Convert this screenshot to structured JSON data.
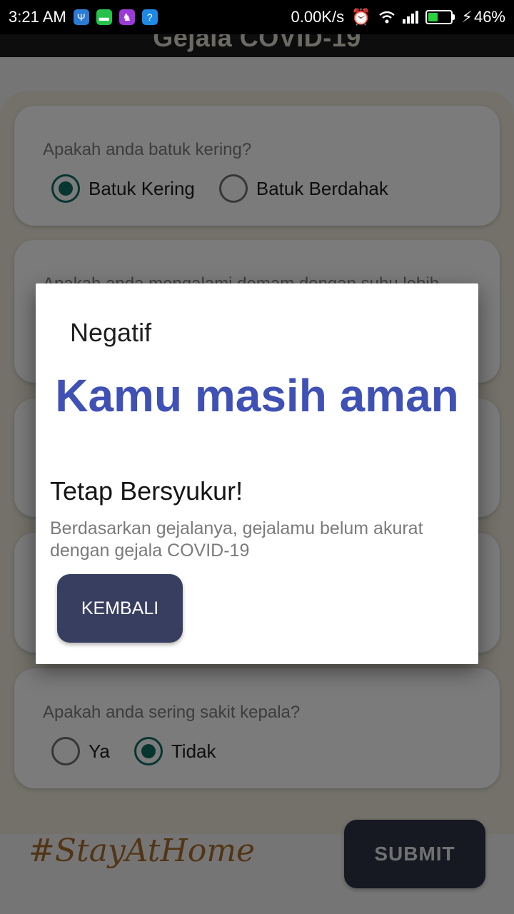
{
  "status_bar": {
    "time": "3:21 AM",
    "net_speed": "0.00K/s",
    "battery_percent": "46%",
    "battery_level": 0.46,
    "notification_icons": [
      "usb-icon",
      "message-icon",
      "game-icon",
      "store-icon"
    ]
  },
  "app_bar": {
    "title": "Gejala COVID-19"
  },
  "questions": [
    {
      "text": "Apakah anda batuk kering?",
      "options": [
        "Batuk Kering",
        "Batuk Berdahak"
      ],
      "selected": 0
    },
    {
      "text": "Apakah anda mengalami demam dengan suhu lebih"
    },
    {
      "text": "Apakah anda sering sakit kepala?",
      "options": [
        "Ya",
        "Tidak"
      ],
      "selected": 1
    }
  ],
  "footer": {
    "hashtag": "#StayAtHome",
    "submit_label": "SUBMIT"
  },
  "dialog": {
    "title": "Negatif",
    "headline": "Kamu masih aman",
    "subtitle": "Tetap Bersyukur!",
    "message": "Berdasarkan gejalanya, gejalamu belum akurat dengan gejala COVID-19",
    "button_label": "KEMBALI"
  },
  "colors": {
    "accent_radio": "#0e6c60",
    "headline": "#3f51b5",
    "button": "#383e5f",
    "hashtag": "#a56a2a"
  }
}
